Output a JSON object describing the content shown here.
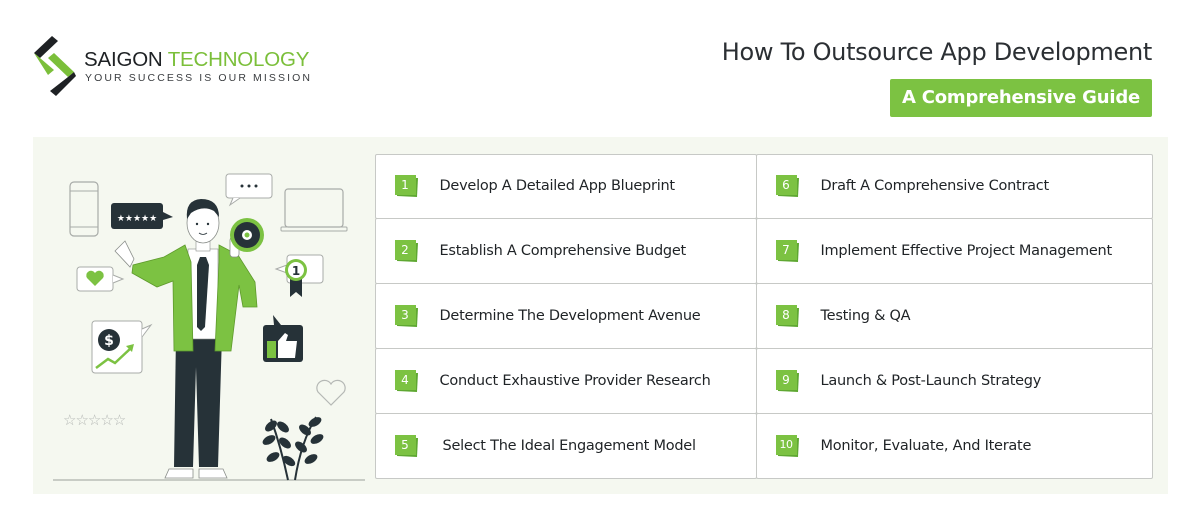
{
  "brand": {
    "name_part1": "SAIGON",
    "name_part2": "TECHNOLOGY",
    "tagline": "YOUR SUCCESS IS OUR MISSION"
  },
  "header": {
    "title": "How To Outsource App Development",
    "subtitle": "A Comprehensive Guide"
  },
  "colors": {
    "accent_green": "#7cc242",
    "dark": "#263238",
    "panel_bg": "#f5f8f0"
  },
  "illustration": {
    "description": "Businessman in green jacket holding megaphone surrounded by icons",
    "icons": [
      "phone-icon",
      "five-star-review-bubble",
      "ellipsis-chat-bubble",
      "laptop-icon",
      "heart-chat-bubble",
      "award-ribbon-1",
      "dollar-growth-chart-bubble",
      "thumbs-up-bubble",
      "heart-outline-icon",
      "five-star-outline-rating",
      "plant-icon"
    ],
    "award_number": "1",
    "dollar_symbol": "$"
  },
  "steps": [
    {
      "num": "1",
      "label": "Develop A Detailed App Blueprint"
    },
    {
      "num": "2",
      "label": "Establish A Comprehensive Budget"
    },
    {
      "num": "3",
      "label": "Determine The Development Avenue"
    },
    {
      "num": "4",
      "label": "Conduct Exhaustive Provider Research"
    },
    {
      "num": "5",
      "label": "Select The Ideal Engagement Model"
    },
    {
      "num": "6",
      "label": "Draft A Comprehensive Contract"
    },
    {
      "num": "7",
      "label": "Implement Effective Project Management"
    },
    {
      "num": "8",
      "label": "Testing & QA"
    },
    {
      "num": "9",
      "label": "Launch & Post-Launch Strategy"
    },
    {
      "num": "10",
      "label": "Monitor, Evaluate, And Iterate"
    }
  ]
}
